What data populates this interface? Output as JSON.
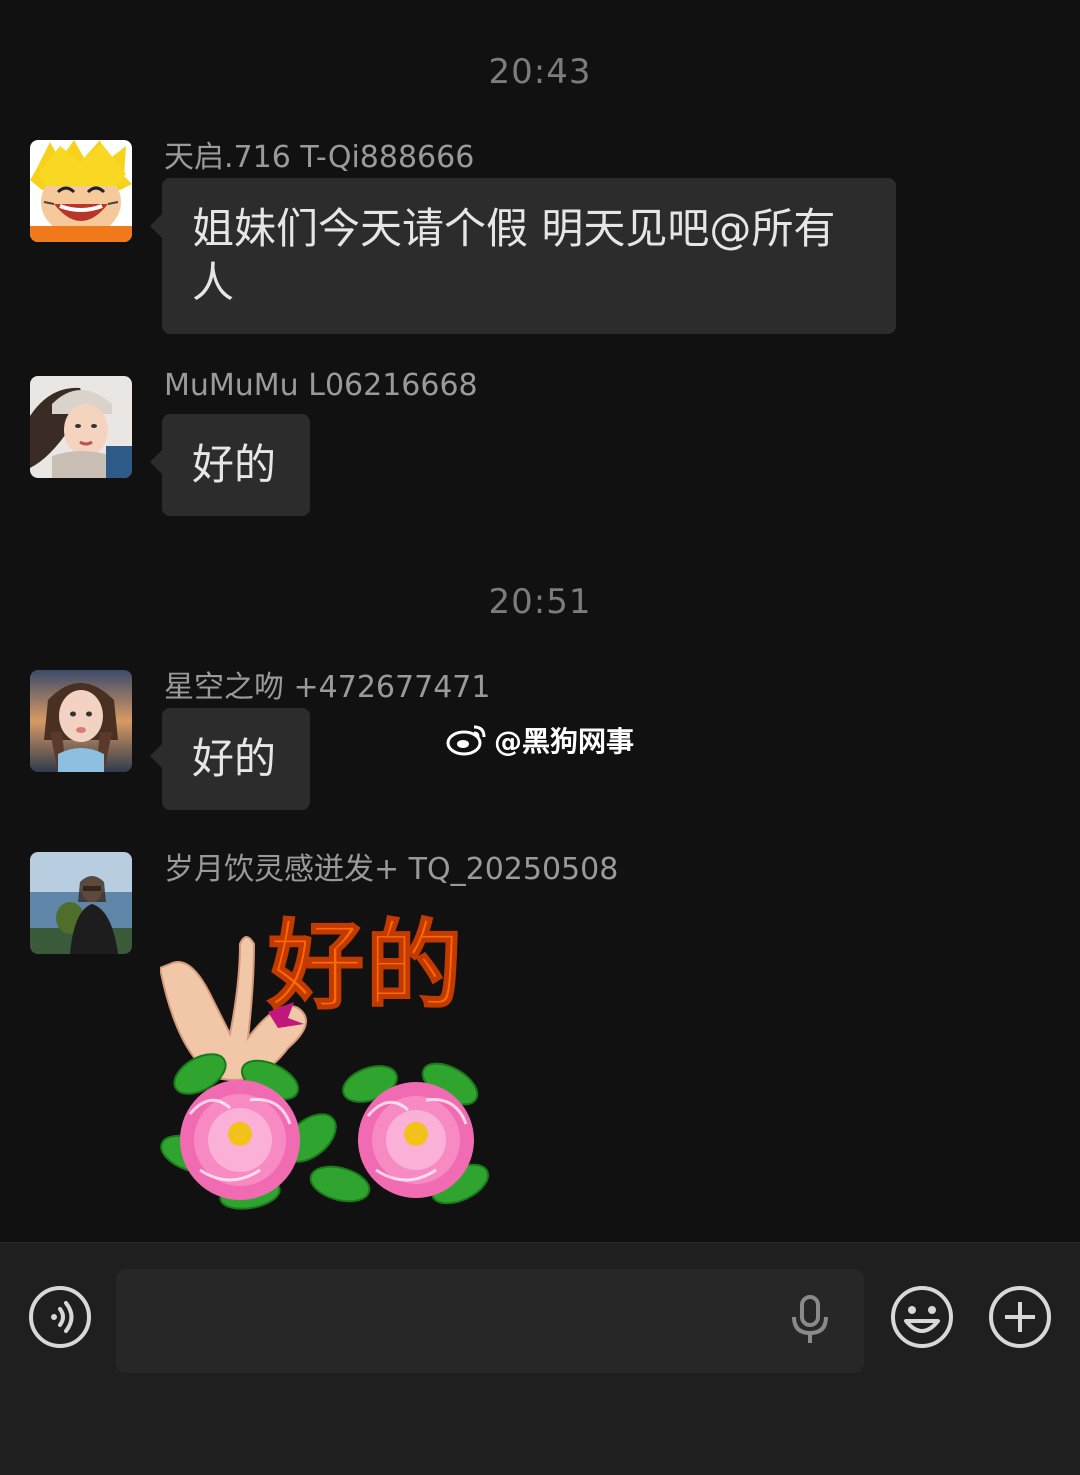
{
  "chat": {
    "timestamps": [
      "20:43",
      "20:51"
    ],
    "messages": [
      {
        "sender": "天启.716 T-Qi888666",
        "text": "姐妹们今天请个假 明天见吧@所有人",
        "avatar_icon": "cartoon-boy-avatar"
      },
      {
        "sender": "MuMuMu  L06216668",
        "text": "好的",
        "avatar_icon": "girl-in-beanie-avatar"
      },
      {
        "sender": "星空之吻 +472677471",
        "text": "好的",
        "avatar_icon": "girl-portrait-avatar"
      },
      {
        "sender": "岁月饮灵感迸发+ TQ_20250508",
        "sticker_text": "好的",
        "avatar_icon": "woman-by-sea-avatar"
      }
    ]
  },
  "watermark": {
    "text": "@黑狗网事",
    "icon": "weibo-icon"
  },
  "input_bar": {
    "voice_icon": "voice-mode-icon",
    "mic_icon": "microphone-icon",
    "emoji_icon": "emoji-icon",
    "plus_icon": "plus-icon"
  }
}
